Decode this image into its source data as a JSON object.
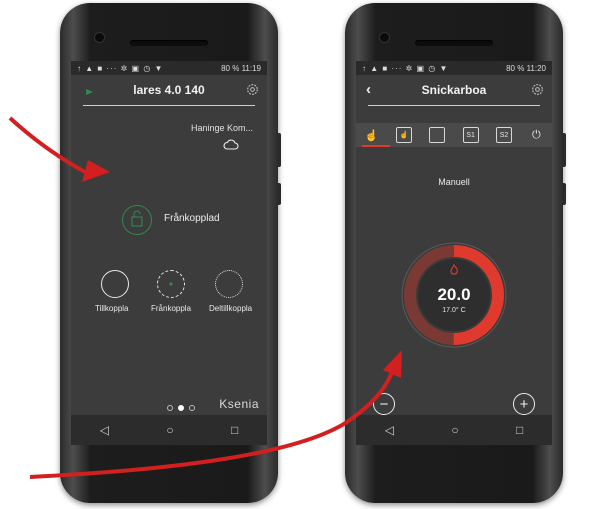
{
  "phones": {
    "left": {
      "status_bar": {
        "icons": "↑ ▲ ■ ··· ✲ ▣ ◷ ▼",
        "battery": "80 %",
        "time": "11:19"
      },
      "header": {
        "title": "lares 4.0 140",
        "status_icon": "green-status-dot",
        "settings_icon": "gear-icon"
      },
      "site": {
        "name": "Haninge Kom...",
        "weather_icon": "cloud-icon"
      },
      "status": {
        "label": "Frånkopplad",
        "icon": "partition-icon"
      },
      "modes": [
        {
          "label": "Tillkoppla"
        },
        {
          "label": "Frånkoppla"
        },
        {
          "label": "Deltillkoppla"
        }
      ],
      "logo": "Ksenia",
      "nav": {
        "back": "◁",
        "home": "○",
        "recents": "□"
      }
    },
    "right": {
      "status_bar": {
        "icons": "↑ ▲ ■ ··· ✲ ▣ ◷ ▼",
        "battery": "80 %",
        "time": "11:20"
      },
      "header": {
        "title": "Snickarboa",
        "back": "‹",
        "settings_icon": "gear-icon"
      },
      "tabs": [
        {
          "icon": "hand-icon",
          "glyph": "☝"
        },
        {
          "icon": "touch-icon",
          "glyph": "☝"
        },
        {
          "icon": "calendar-icon",
          "glyph": ""
        },
        {
          "icon": "schedule-s1-icon",
          "glyph": "S1"
        },
        {
          "icon": "schedule-s2-icon",
          "glyph": "S2"
        },
        {
          "icon": "power-icon",
          "glyph": "⏻"
        }
      ],
      "mode": "Manuell",
      "thermostat": {
        "setpoint": "20.0",
        "current": "17.0° C",
        "fill_fraction": 0.5,
        "accent": "#e03a2e"
      },
      "buttons": {
        "minus": "−",
        "plus": "+"
      },
      "nav": {
        "back": "◁",
        "home": "○",
        "recents": "□"
      }
    }
  },
  "colors": {
    "accent": "#e03a2e",
    "green": "#2f8a4d",
    "screen": "#3c3c3c"
  }
}
